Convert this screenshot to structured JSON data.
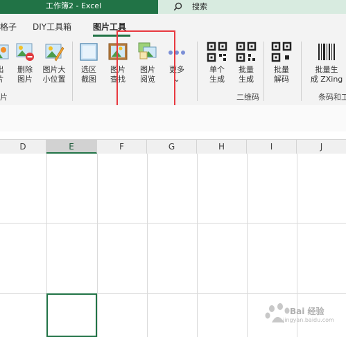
{
  "window": {
    "title": "工作簿2  -  Excel"
  },
  "search": {
    "label": "搜索"
  },
  "tabs": [
    {
      "label": "格子"
    },
    {
      "label": "DIY工具箱"
    },
    {
      "label": "图片工具",
      "active": true
    }
  ],
  "ribbon": {
    "buttons": [
      {
        "label": "出\n片"
      },
      {
        "label": "删除\n图片"
      },
      {
        "label": "图片大\n小位置"
      },
      {
        "label": "选区\n截图"
      },
      {
        "label": "图片\n查找"
      },
      {
        "label": "图片\n阅览"
      },
      {
        "label": "更多\n⌄"
      },
      {
        "label": "单个\n生成"
      },
      {
        "label": "批量\n生成"
      },
      {
        "label": "批量\n解码"
      },
      {
        "label": "批量生\n成 ZXing"
      }
    ],
    "groups": [
      {
        "label": "片"
      },
      {
        "label": "二维码"
      },
      {
        "label": "条码和工"
      }
    ]
  },
  "sheet": {
    "columns": [
      "D",
      "E",
      "F",
      "G",
      "H",
      "I",
      "J"
    ],
    "selected_column": "E"
  },
  "watermark": {
    "text": "Bai 经验",
    "url": "jingyan.baidu.com"
  },
  "colors": {
    "excel_green": "#217346",
    "highlight_red": "#e8393f"
  }
}
